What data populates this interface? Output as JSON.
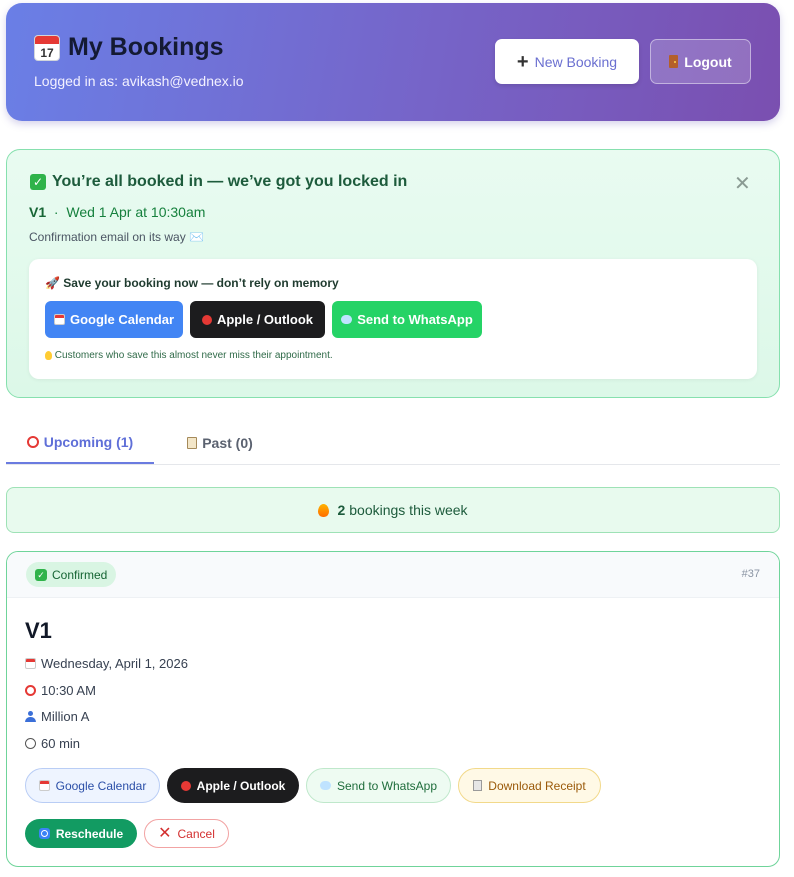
{
  "header": {
    "icon_day": "17",
    "title": "My Bookings",
    "subtitle": "Logged in as: avikash@vednex.io",
    "new_booking_label": "New Booking",
    "logout_label": "Logout"
  },
  "success": {
    "title": "You’re all booked in — we’ve got you locked in",
    "service": "V1",
    "separator": "·",
    "when": "Wed 1 Apr at 10:30am",
    "note": "Confirmation email on its way ✉️",
    "save_title": "Save your booking now — don’t rely on memory",
    "buttons": {
      "google": "Google Calendar",
      "apple": "Apple / Outlook",
      "whatsapp": "Send to WhatsApp"
    },
    "hint": "Customers who save this almost never miss their appointment."
  },
  "tabs": [
    {
      "label": "Upcoming (1)",
      "active": true
    },
    {
      "label": "Past (0)",
      "active": false
    }
  ],
  "week": {
    "count": "2",
    "text": "bookings this week"
  },
  "booking": {
    "status": "Confirmed",
    "id": "#37",
    "title": "V1",
    "date": "Wednesday, April 1, 2026",
    "time": "10:30 AM",
    "staff": "Million A",
    "duration": "60 min",
    "actions": {
      "google": "Google Calendar",
      "apple": "Apple / Outlook",
      "whatsapp": "Send to WhatsApp",
      "receipt": "Download Receipt",
      "reschedule": "Reschedule",
      "cancel": "Cancel"
    }
  },
  "colors": {
    "header_gradient_start": "#6a7fe6",
    "header_gradient_end": "#7a4fb0",
    "success_border": "#86e0ae",
    "google_blue": "#4285f4",
    "whatsapp_green": "#25d366",
    "reschedule_green": "#129b62",
    "cancel_red": "#d32f2f"
  }
}
